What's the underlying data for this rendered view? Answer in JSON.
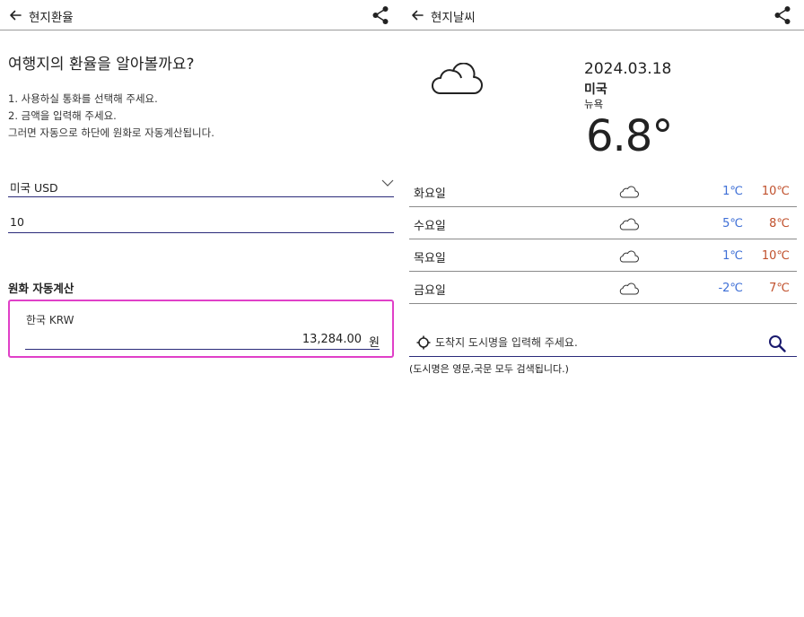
{
  "exchange": {
    "title": "현지환율",
    "heading": "여행지의 환율을 알아볼까요?",
    "instructions": [
      "1. 사용하실 통화를 선택해 주세요.",
      "2. 금액을 입력해 주세요.",
      "그러면 자동으로 하단에 원화로 자동계산됩니다."
    ],
    "currency_select": "미국 USD",
    "amount": "10",
    "auto_calc_label": "원화 자동계산",
    "result": {
      "currency_label": "한국 KRW",
      "value": "13,284.00",
      "unit": "원"
    }
  },
  "weather": {
    "title": "현지날씨",
    "date": "2024.03.18",
    "country": "미국",
    "city": "뉴욕",
    "temperature": "6.8°",
    "icon": "cloud-icon",
    "forecast": [
      {
        "day": "화요일",
        "icon": "cloud-icon",
        "min": "1℃",
        "max": "10℃"
      },
      {
        "day": "수요일",
        "icon": "cloud-icon",
        "min": "5℃",
        "max": "8℃"
      },
      {
        "day": "목요일",
        "icon": "cloud-icon",
        "min": "1℃",
        "max": "10℃"
      },
      {
        "day": "금요일",
        "icon": "cloud-icon",
        "min": "-2℃",
        "max": "7℃"
      }
    ],
    "search_placeholder": "도착지 도시명을 입력해 주세요.",
    "search_hint": "(도시명은 영문,국문 모두 검색됩니다.)"
  },
  "colors": {
    "min_temp": "#3e6fd6",
    "max_temp": "#c0502c",
    "result_border": "#e040c8",
    "underline": "#2a2a7a"
  }
}
